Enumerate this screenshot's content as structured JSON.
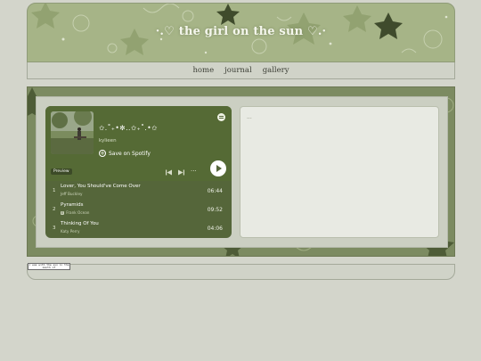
{
  "site": {
    "title": "·.♡ the girl on the sun ♡.·"
  },
  "nav": {
    "items": [
      {
        "label": "home"
      },
      {
        "label": "journal"
      },
      {
        "label": "gallery"
      }
    ]
  },
  "spotify": {
    "playlist_title": "✩.˚₊•✼..✩₊˚.•✩",
    "owner": "kylieen",
    "save_label": "Save on Spotify",
    "preview_label": "Preview",
    "more_label": "···",
    "tracks": [
      {
        "num": "1",
        "name": "Lover, You Should've Come Over",
        "artist": "Jeff Buckley",
        "explicit": false,
        "duration": "06:44"
      },
      {
        "num": "2",
        "name": "Pyramids",
        "artist": "Frank Ocean",
        "explicit": true,
        "explicit_label": "E",
        "duration": "09:52"
      },
      {
        "num": "3",
        "name": "Thinking Of You",
        "artist": "Katy Perry",
        "explicit": false,
        "duration": "04:06"
      }
    ],
    "colors": {
      "background": "#55663a",
      "accent": "#ffffff"
    }
  },
  "panel": {
    "placeholder": "..."
  },
  "footer": {
    "badge_text": "i was with the sun in the month of"
  },
  "icons": [
    "spotify-logo-icon",
    "plus-circle-icon",
    "previous-track-icon",
    "next-track-icon",
    "more-options-icon",
    "play-icon"
  ]
}
